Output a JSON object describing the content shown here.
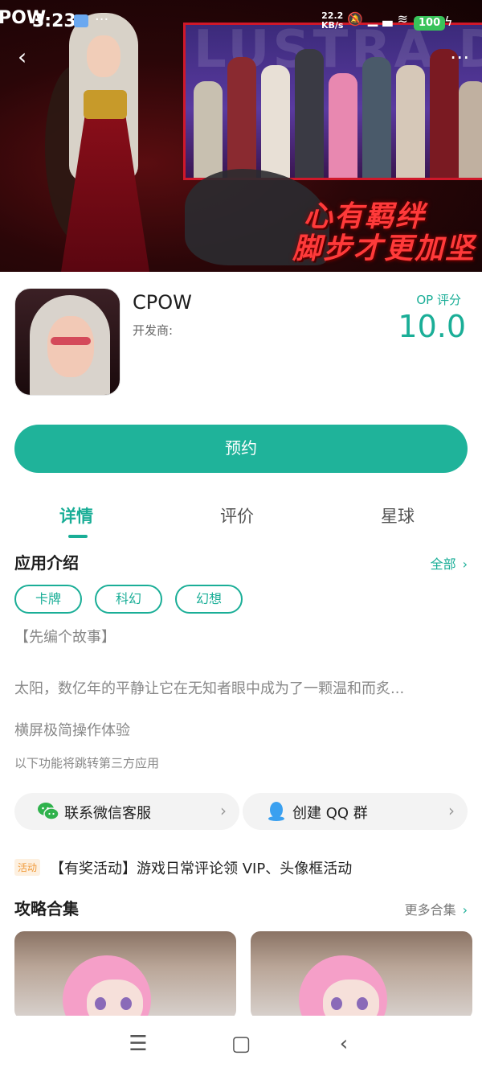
{
  "status_bar": {
    "time": "3:23",
    "app_logo": "POW",
    "net_speed_value": "22.2",
    "net_speed_unit": "KB/s",
    "battery": "100"
  },
  "banner": {
    "bg_text": "LUSTRA D BOO",
    "slogan_line1": "心有羁绊",
    "slogan_line2": "脚步才更加坚"
  },
  "app": {
    "name": "CPOW",
    "developer_label": "开发商:",
    "score_label": "OP 评分",
    "score_value": "10.0"
  },
  "reserve_button": "预约",
  "tabs": [
    {
      "label": "详情",
      "active": true
    },
    {
      "label": "评价",
      "active": false
    },
    {
      "label": "星球",
      "active": false
    }
  ],
  "intro": {
    "title": "应用介绍",
    "all_link": "全部",
    "tags": [
      "卡牌",
      "科幻",
      "幻想"
    ],
    "paragraph1": "【先编个故事】",
    "paragraph2": "太阳，数亿年的平静让它在无知者眼中成为了一颗温和而炙...",
    "paragraph3": "横屏极简操作体验"
  },
  "third_party_note": "以下功能将跳转第三方应用",
  "links": {
    "wechat": "联系微信客服",
    "qq": "创建 QQ 群"
  },
  "activity": {
    "badge": "活动",
    "text": "【有奖活动】游戏日常评论领 VIP、头像框活动"
  },
  "guides": {
    "title": "攻略合集",
    "more_link": "更多合集"
  },
  "colors": {
    "accent": "#1aae97",
    "button": "#1fb39a"
  }
}
